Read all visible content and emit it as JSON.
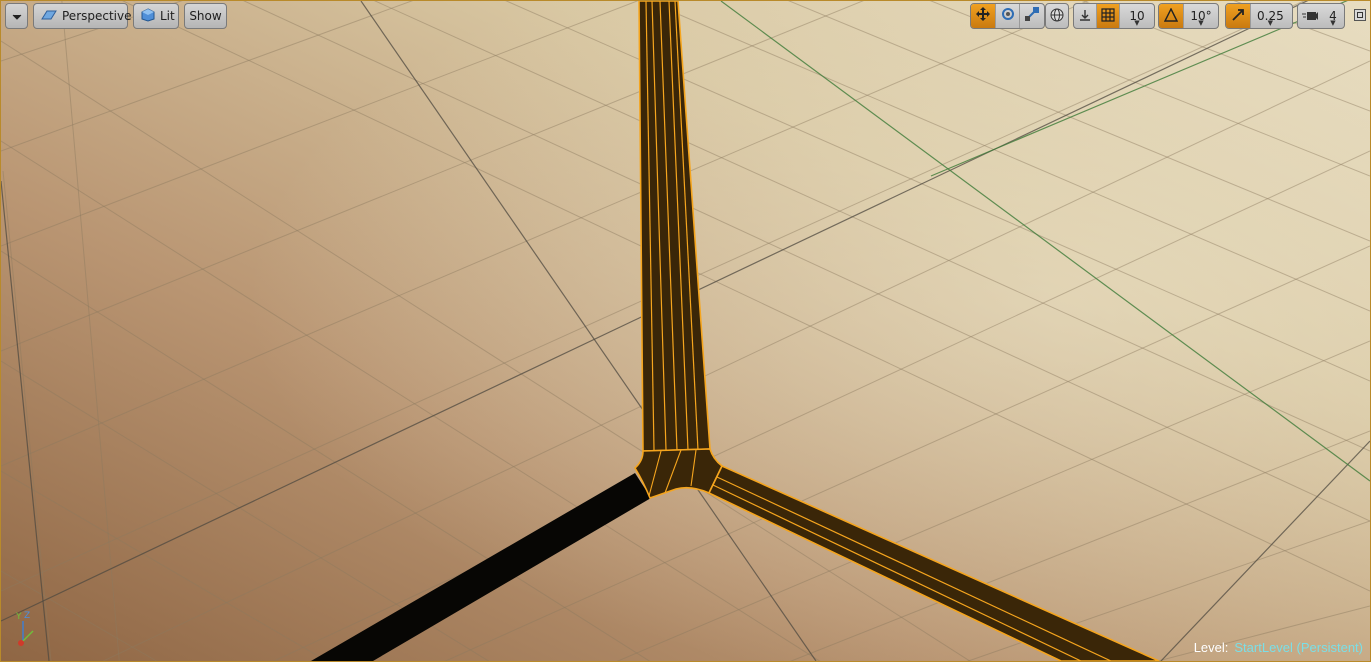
{
  "toolbar": {
    "view_mode": "Perspective",
    "lighting": "Lit",
    "show": "Show",
    "grid_snap": "10",
    "rotation_snap": "10°",
    "scale_snap": "0.25",
    "camera_speed": "4",
    "icons": [
      "dropdown-icon",
      "perspective-icon",
      "lit-icon",
      "translate-icon",
      "rotate-icon",
      "scale-icon",
      "world-icon",
      "surface-snap-icon",
      "grid-icon",
      "rotation-snap-icon",
      "scale-snap-icon",
      "camera-speed-icon",
      "maximize-icon"
    ]
  },
  "status": {
    "level_label": "Level:",
    "level_value": "StartLevel (Persistent)"
  },
  "axes": {
    "y": "Y",
    "z": "Z"
  },
  "colors": {
    "selection": "#f5a51e",
    "road_fill": "#3a2608",
    "floor_light": "#e3d6b8",
    "floor_dark": "#9b7352",
    "level_value": "#7adfe7"
  }
}
